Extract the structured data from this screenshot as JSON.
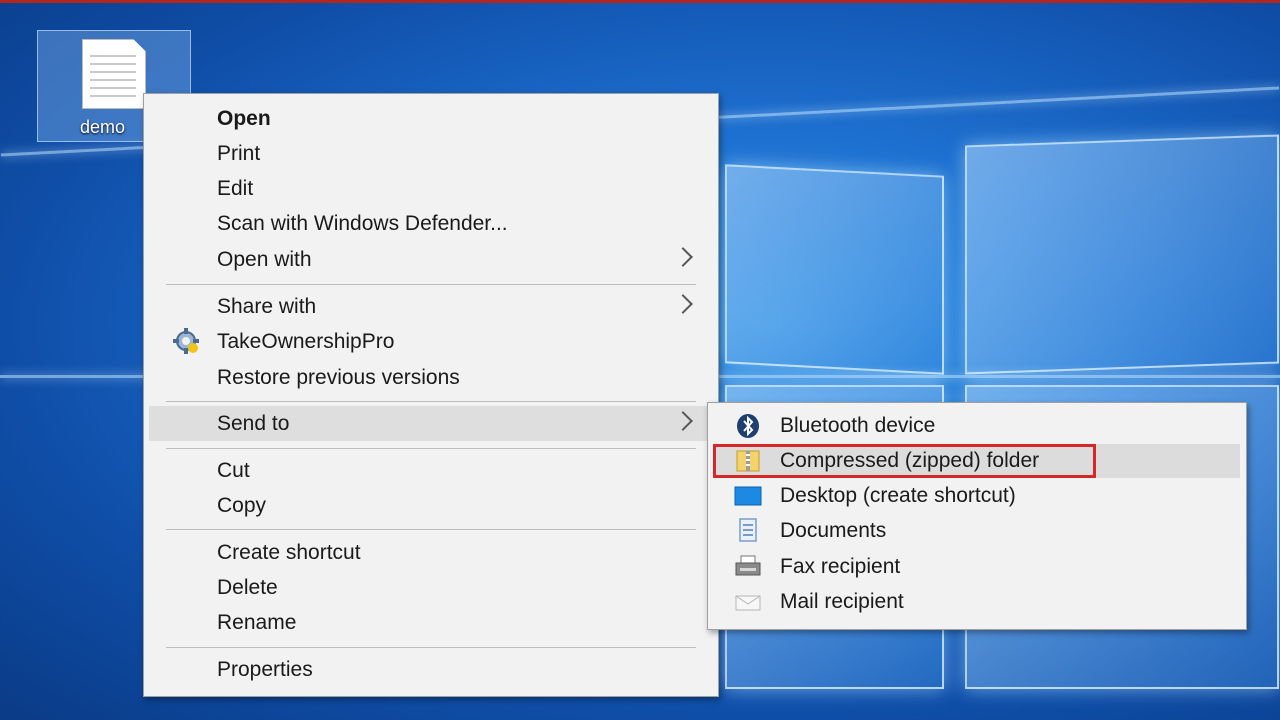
{
  "desktop": {
    "icon_label": "demo"
  },
  "context_menu": {
    "items": [
      {
        "label": "Open"
      },
      {
        "label": "Print"
      },
      {
        "label": "Edit"
      },
      {
        "label": "Scan with Windows Defender..."
      },
      {
        "label": "Open with"
      },
      {
        "label": "Share with"
      },
      {
        "label": "TakeOwnershipPro"
      },
      {
        "label": "Restore previous versions"
      },
      {
        "label": "Send to"
      },
      {
        "label": "Cut"
      },
      {
        "label": "Copy"
      },
      {
        "label": "Create shortcut"
      },
      {
        "label": "Delete"
      },
      {
        "label": "Rename"
      },
      {
        "label": "Properties"
      }
    ]
  },
  "send_to_menu": {
    "items": [
      {
        "label": "Bluetooth device",
        "icon": "bluetooth-icon"
      },
      {
        "label": "Compressed (zipped) folder",
        "icon": "zip-folder-icon"
      },
      {
        "label": "Desktop (create shortcut)",
        "icon": "desktop-icon"
      },
      {
        "label": "Documents",
        "icon": "documents-icon"
      },
      {
        "label": "Fax recipient",
        "icon": "fax-icon"
      },
      {
        "label": "Mail recipient",
        "icon": "mail-icon"
      }
    ]
  },
  "colors": {
    "highlight_border": "#d62828",
    "menu_background": "#f2f2f2",
    "hover_background": "#dedede"
  }
}
